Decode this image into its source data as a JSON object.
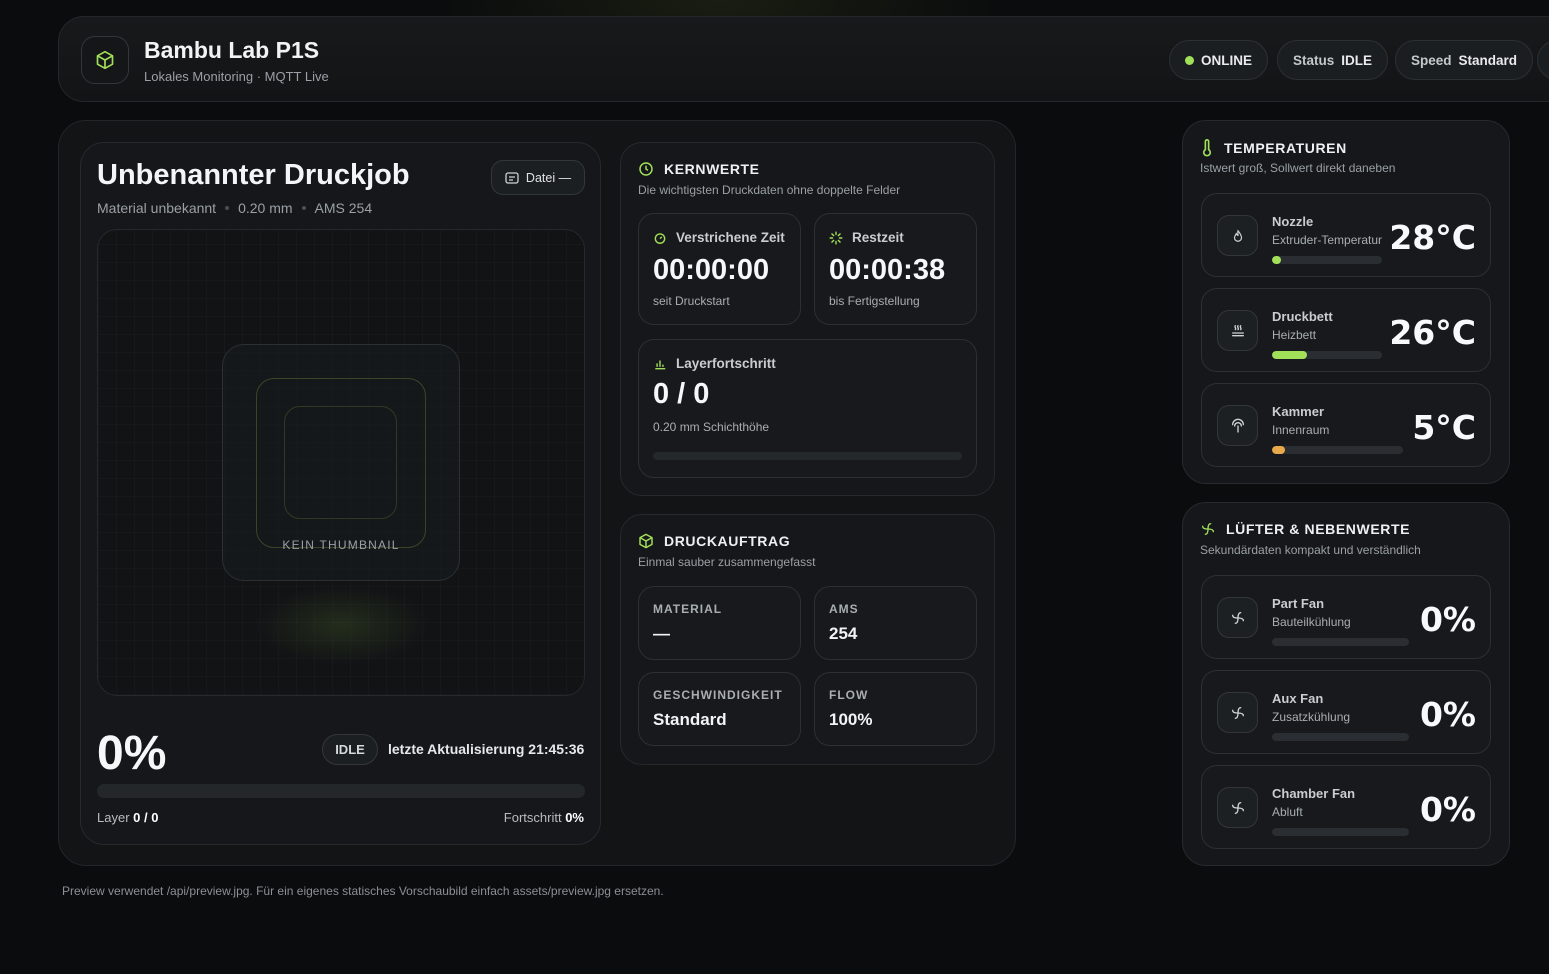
{
  "header": {
    "title": "Bambu Lab P1S",
    "subtitle": "Lokales Monitoring · MQTT Live",
    "online_label": "ONLINE",
    "status_label": "Status",
    "status_value": "IDLE",
    "speed_label": "Speed",
    "speed_value": "Standard"
  },
  "job": {
    "title": "Unbenannter Druckjob",
    "material": "Material unbekannt",
    "layer_height": "0.20 mm",
    "ams": "AMS 254",
    "file_button": "Datei —",
    "thumbnail_label": "KEIN THUMBNAIL",
    "progress_text": "0%",
    "progress_value": 0,
    "state": "IDLE",
    "last_update": "letzte Aktualisierung 21:45:36",
    "layer_label": "Layer",
    "layer_value": "0 / 0",
    "progress_label": "Fortschritt",
    "progress_small": "0%"
  },
  "core": {
    "title": "KERNWERTE",
    "subtitle": "Die wichtigsten Druckdaten ohne doppelte Felder",
    "elapsed_label": "Verstrichene Zeit",
    "elapsed_value": "00:00:00",
    "elapsed_sub": "seit Druckstart",
    "remaining_label": "Restzeit",
    "remaining_value": "00:00:38",
    "remaining_sub": "bis Fertigstellung",
    "layer_label": "Layerfortschritt",
    "layer_value": "0 / 0",
    "layer_sub": "0.20 mm Schichthöhe",
    "layer_progress": 0
  },
  "order": {
    "title": "DRUCKAUFTRAG",
    "subtitle": "Einmal sauber zusammengefasst",
    "material_label": "MATERIAL",
    "material_value": "—",
    "ams_label": "AMS",
    "ams_value": "254",
    "speed_label": "GESCHWINDIGKEIT",
    "speed_value": "Standard",
    "flow_label": "FLOW",
    "flow_value": "100%"
  },
  "temps": {
    "title": "TEMPERATUREN",
    "subtitle": "Istwert groß, Sollwert direkt daneben",
    "items": [
      {
        "name": "Nozzle",
        "desc": "Extruder-Temperatur",
        "value": "28°C",
        "level": 0.08,
        "color": "#a3e05a",
        "icon": "flame-icon"
      },
      {
        "name": "Druckbett",
        "desc": "Heizbett",
        "value": "26°C",
        "level": 0.32,
        "color": "#a3e05a",
        "icon": "heat-bed-icon"
      },
      {
        "name": "Kammer",
        "desc": "Innenraum",
        "value": "5°C",
        "level": 0.1,
        "color": "#e8a94a",
        "icon": "chamber-icon"
      }
    ]
  },
  "fans": {
    "title": "LÜFTER & NEBENWERTE",
    "subtitle": "Sekundärdaten kompakt und verständlich",
    "items": [
      {
        "name": "Part Fan",
        "desc": "Bauteilkühlung",
        "value": "0%",
        "level": 0,
        "icon": "fan-icon"
      },
      {
        "name": "Aux Fan",
        "desc": "Zusatzkühlung",
        "value": "0%",
        "level": 0,
        "icon": "fan-icon"
      },
      {
        "name": "Chamber Fan",
        "desc": "Abluft",
        "value": "0%",
        "level": 0,
        "icon": "fan-icon"
      }
    ]
  },
  "footnote": "Preview verwendet /api/preview.jpg. Für ein eigenes statisches Vorschaubild einfach assets/preview.jpg ersetzen.",
  "colors": {
    "accent": "#a3e05a",
    "warm": "#e8a94a",
    "background": "#0b0c0d"
  }
}
